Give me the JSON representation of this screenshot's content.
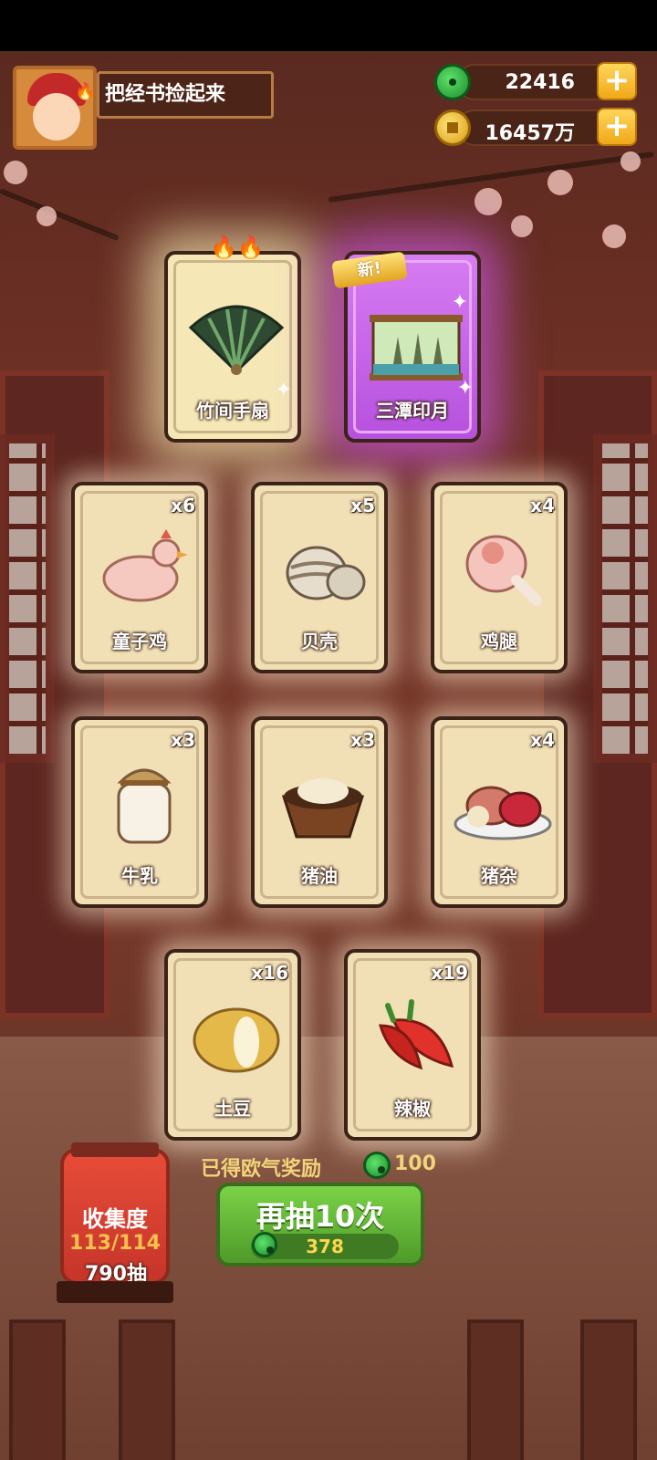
{
  "quest": {
    "title": "把经书捡起来"
  },
  "currencies": [
    {
      "icon": "jade-icon",
      "value": "22416"
    },
    {
      "icon": "coin-icon",
      "value": "16457万"
    }
  ],
  "top_cards": [
    {
      "name": "竹间手扇",
      "rarity": "gold",
      "icon": "bamboo-fan-icon"
    },
    {
      "name": "三潭印月",
      "rarity": "purple",
      "icon": "scenery-scroll-icon",
      "tag": "新!"
    }
  ],
  "cards": [
    {
      "name": "童子鸡",
      "qty": "x6",
      "icon": "chicken-icon"
    },
    {
      "name": "贝壳",
      "qty": "x5",
      "icon": "shell-icon"
    },
    {
      "name": "鸡腿",
      "qty": "x4",
      "icon": "drumstick-icon"
    },
    {
      "name": "牛乳",
      "qty": "x3",
      "icon": "milk-jar-icon"
    },
    {
      "name": "猪油",
      "qty": "x3",
      "icon": "lard-bowl-icon"
    },
    {
      "name": "猪杂",
      "qty": "x4",
      "icon": "offal-plate-icon"
    },
    {
      "name": "土豆",
      "qty": "x16",
      "icon": "potato-icon"
    },
    {
      "name": "辣椒",
      "qty": "x19",
      "icon": "chili-icon"
    }
  ],
  "background_badge": "790抽",
  "collection": {
    "label": "收集度",
    "progress": "113/114",
    "draws": "790抽"
  },
  "reward": {
    "label": "已得欧气奖励",
    "amount": "100"
  },
  "draw_button": {
    "label": "再抽10次",
    "cost": "378"
  }
}
